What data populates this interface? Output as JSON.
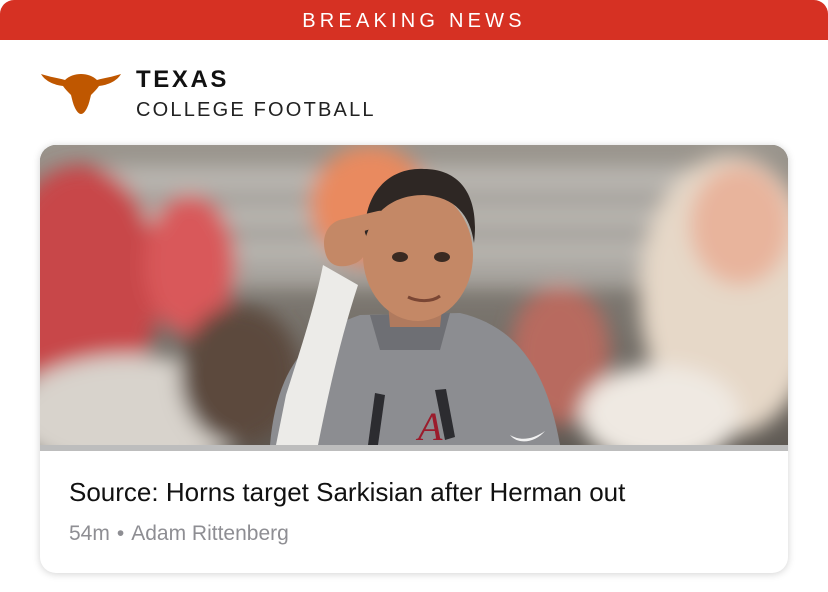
{
  "banner": {
    "label": "BREAKING NEWS"
  },
  "team": {
    "logo_icon": "longhorn-logo-icon",
    "name": "TEXAS",
    "subtitle": "COLLEGE FOOTBALL"
  },
  "article": {
    "image": "coach-pointing-photo",
    "headline": "Source: Horns target Sarkisian after Herman out",
    "age": "54m",
    "separator": "•",
    "author": "Adam Rittenberg"
  },
  "colors": {
    "banner": "#d63123",
    "burnt_orange": "#bf5700",
    "meta_gray": "#8e8e93"
  }
}
